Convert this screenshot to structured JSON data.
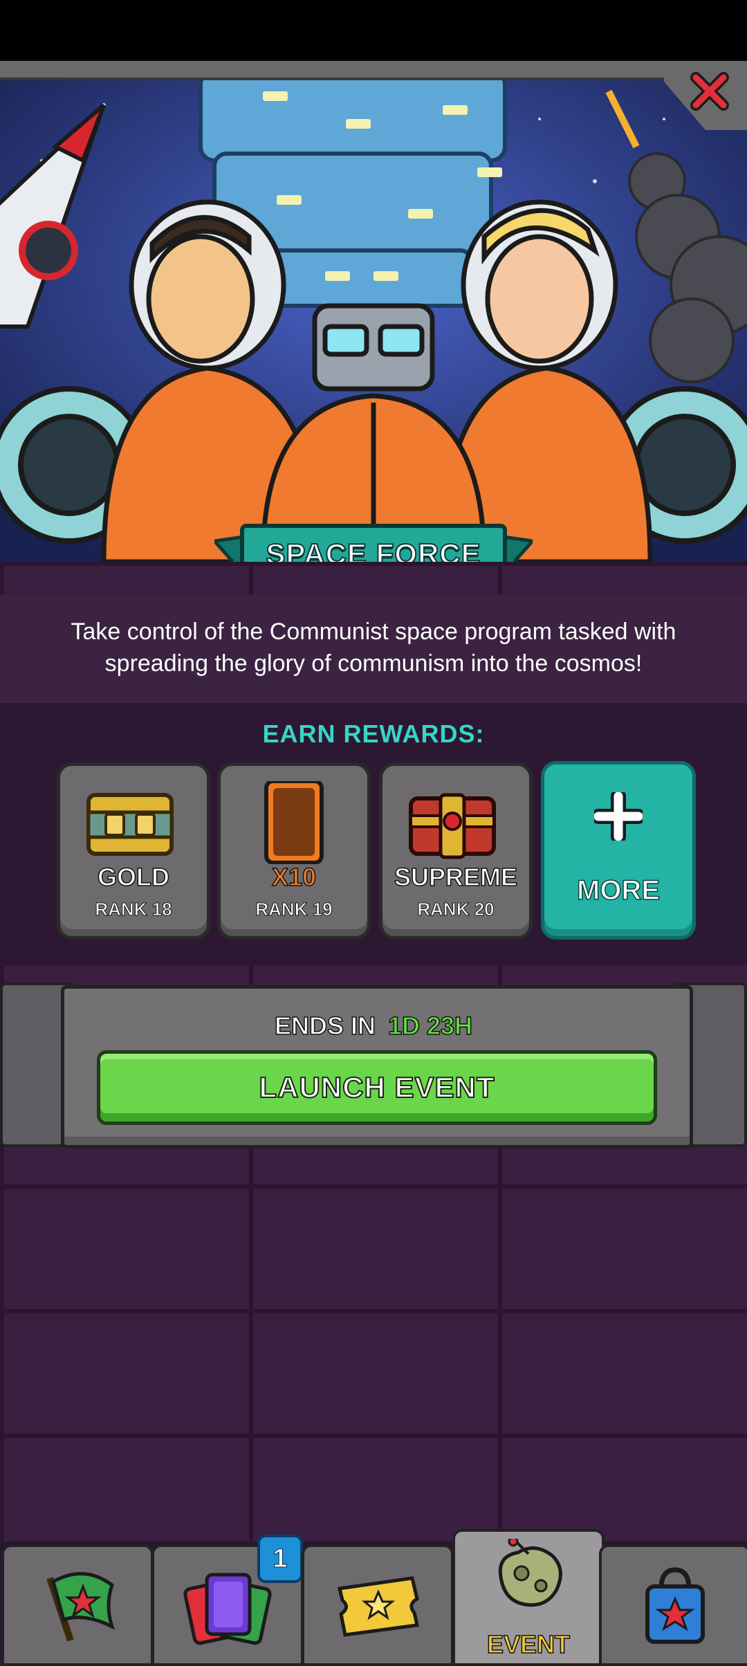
{
  "event": {
    "title": "SPACE FORCE",
    "description": "Take control of the Communist space program tasked with spreading the glory of communism into the cosmos!",
    "earn_rewards_label": "EARN REWARDS:",
    "rewards": [
      {
        "name": "GOLD",
        "rank": "RANK 18",
        "icon": "gold-chest-icon",
        "name_color": "#ffffff"
      },
      {
        "name": "X10",
        "rank": "RANK 19",
        "icon": "card-pack-icon",
        "name_color": "#f07b22"
      },
      {
        "name": "SUPREME",
        "rank": "RANK 20",
        "icon": "supreme-chest-icon",
        "name_color": "#ffffff"
      }
    ],
    "more_label": "MORE",
    "ends_in_label": "ENDS IN",
    "ends_in_time": "1D 23H",
    "launch_label": "LAUNCH EVENT"
  },
  "nav": {
    "tabs": [
      {
        "icon": "flag-icon",
        "label": ""
      },
      {
        "icon": "cards-icon",
        "label": "",
        "badge": "1"
      },
      {
        "icon": "ticket-icon",
        "label": ""
      },
      {
        "icon": "asteroid-event-icon",
        "label": "EVENT",
        "active": true
      },
      {
        "icon": "shop-bag-icon",
        "label": ""
      }
    ]
  },
  "colors": {
    "accent_teal": "#23b4a6",
    "launch_green": "#6bd54b",
    "time_green": "#62e23f",
    "background_purple": "#3a1f40"
  }
}
